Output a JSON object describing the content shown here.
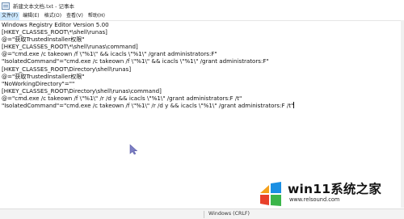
{
  "window": {
    "title": "新建文本文档.txt - 记事本"
  },
  "menu": [
    {
      "label": "文件(F)",
      "active": true
    },
    {
      "label": "编辑(E)",
      "active": false
    },
    {
      "label": "格式(O)",
      "active": false
    },
    {
      "label": "查看(V)",
      "active": false
    },
    {
      "label": "帮助(H)",
      "active": false
    }
  ],
  "editor": {
    "lines": [
      "Windows Registry Editor Version 5.00",
      "[HKEY_CLASSES_ROOT\\*\\shell\\runas]",
      "@=\"获取TrustedInstaller权限\"",
      "[HKEY_CLASSES_ROOT\\*\\shell\\runas\\command]",
      "@=\"cmd.exe /c takeown /f \\\"%1\\\" && icacls \\\"%1\\\" /grant administrators:F\"",
      "\"IsolatedCommand\"=\"cmd.exe /c takeown /f \\\"%1\\\" && icacls \\\"%1\\\" /grant administrators:F\"",
      "[HKEY_CLASSES_ROOT\\Directory\\shell\\runas]",
      "@=\"获取TrustedInstaller权限\"",
      "\"NoWorkingDirectory\"=\"\"",
      "[HKEY_CLASSES_ROOT\\Directory\\shell\\runas\\command]",
      "@=\"cmd.exe /c takeown /f \\\"%1\\\" /r /d y && icacls \\\"%1\\\" /grant administrators:F /t\"",
      "\"IsolatedCommand\"=\"cmd.exe /c takeown /f \\\"%1\\\" /r /d y && icacls \\\"%1\\\" /grant administrators:F /t\""
    ]
  },
  "statusbar": {
    "encoding": "Windows (CRLF)"
  },
  "watermark": {
    "text": "win11系统之家",
    "url": "www.relsound.com",
    "colors": {
      "orange": "#f5a11c",
      "blue": "#1a8fe3",
      "red": "#e8402a",
      "green": "#3bb54a"
    }
  }
}
